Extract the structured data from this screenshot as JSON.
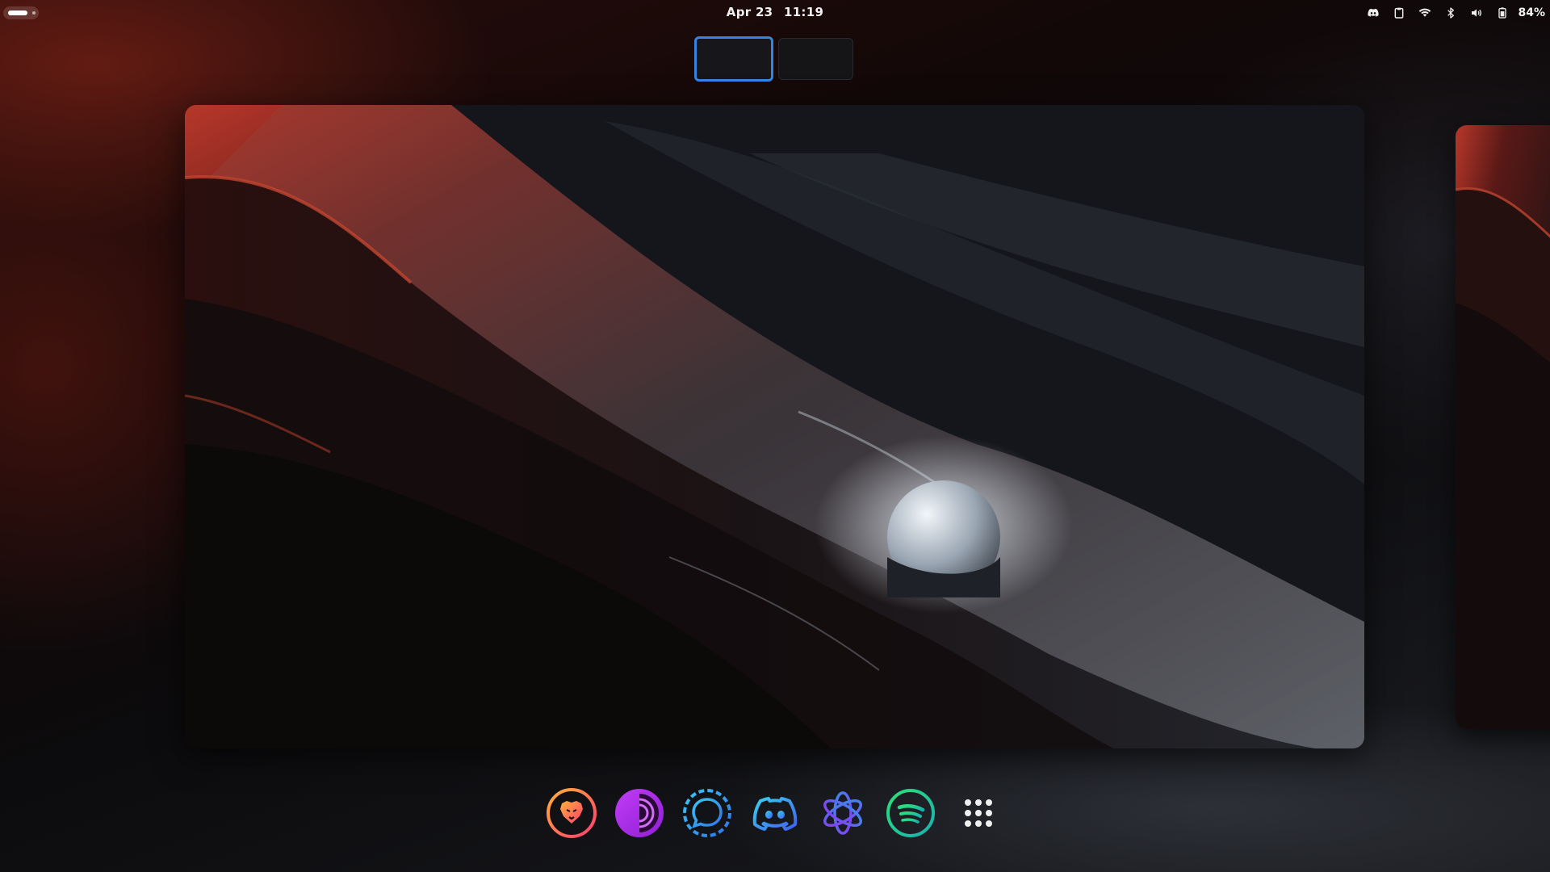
{
  "topbar": {
    "date": "Apr 23",
    "time": "11:19",
    "battery_percent": "84%",
    "tray_icons": [
      "discord-icon",
      "clipboard-icon",
      "wifi-icon",
      "bluetooth-icon",
      "volume-icon",
      "battery-icon"
    ]
  },
  "workspaces": {
    "count": 2,
    "active_index": 0,
    "accent": "#3584e4"
  },
  "dash": {
    "apps": [
      {
        "name": "Brave",
        "icon": "brave-icon"
      },
      {
        "name": "Tor Browser",
        "icon": "tor-browser-icon"
      },
      {
        "name": "Signal",
        "icon": "signal-icon"
      },
      {
        "name": "Discord",
        "icon": "discord-icon"
      },
      {
        "name": "ChatGPT",
        "icon": "chatgpt-icon"
      },
      {
        "name": "Spotify",
        "icon": "spotify-icon"
      },
      {
        "name": "Show Applications",
        "icon": "app-grid-icon"
      }
    ]
  }
}
